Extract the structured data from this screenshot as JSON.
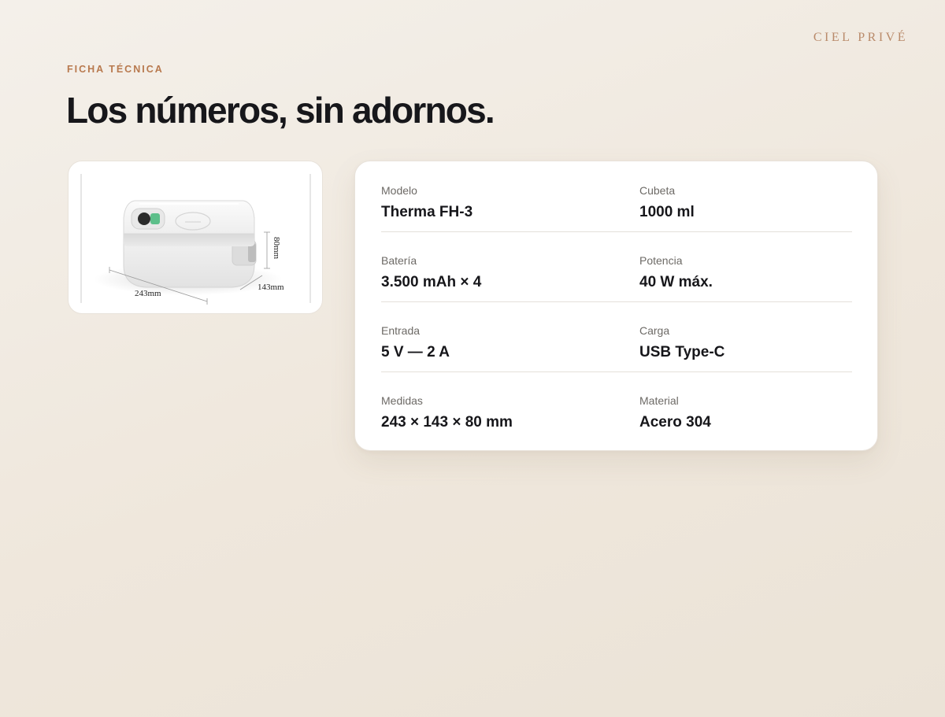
{
  "brand": "CIEL PRIVÉ",
  "eyebrow": "FICHA TÉCNICA",
  "title": "Los números, sin adornos.",
  "product_image": {
    "dimension_labels": {
      "length": "243mm",
      "width": "143mm",
      "height": "80mm"
    }
  },
  "specs": [
    {
      "left": {
        "label": "Modelo",
        "value": "Therma FH-3"
      },
      "right": {
        "label": "Cubeta",
        "value": "1000 ml"
      }
    },
    {
      "left": {
        "label": "Batería",
        "value": "3.500 mAh × 4"
      },
      "right": {
        "label": "Potencia",
        "value": "40 W máx."
      }
    },
    {
      "left": {
        "label": "Entrada",
        "value": "5 V — 2 A"
      },
      "right": {
        "label": "Carga",
        "value": "USB Type-C"
      }
    },
    {
      "left": {
        "label": "Medidas",
        "value": "243 × 143 × 80 mm"
      },
      "right": {
        "label": "Material",
        "value": "Acero 304"
      }
    }
  ]
}
